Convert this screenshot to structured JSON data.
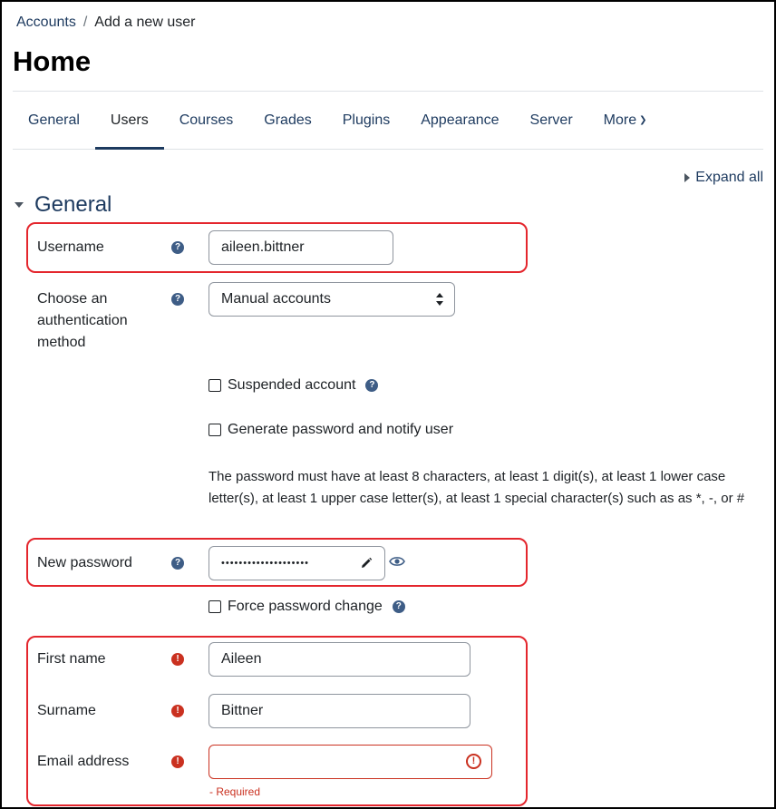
{
  "breadcrumb": {
    "parent": "Accounts",
    "separator": "/",
    "current": "Add a new user"
  },
  "page": {
    "title": "Home"
  },
  "tabs": [
    {
      "label": "General",
      "active": false
    },
    {
      "label": "Users",
      "active": true
    },
    {
      "label": "Courses",
      "active": false
    },
    {
      "label": "Grades",
      "active": false
    },
    {
      "label": "Plugins",
      "active": false
    },
    {
      "label": "Appearance",
      "active": false
    },
    {
      "label": "Server",
      "active": false
    },
    {
      "label": "More",
      "active": false
    }
  ],
  "expand_all": "Expand all",
  "section": {
    "title": "General"
  },
  "form": {
    "username": {
      "label": "Username",
      "value": "aileen.bittner"
    },
    "auth": {
      "label": "Choose an authentication method",
      "selected": "Manual accounts"
    },
    "suspended": {
      "label": "Suspended account",
      "checked": false
    },
    "generate": {
      "label": "Generate password and notify user",
      "checked": false
    },
    "password_policy": "The password must have at least 8 characters, at least 1 digit(s), at least 1 lower case letter(s), at least 1 upper case letter(s), at least 1 special character(s) such as as *, -, or #",
    "new_password": {
      "label": "New password",
      "masked_value": "••••••••••••••••••••"
    },
    "force_change": {
      "label": "Force password change",
      "checked": false
    },
    "first_name": {
      "label": "First name",
      "value": "Aileen"
    },
    "surname": {
      "label": "Surname",
      "value": "Bittner"
    },
    "email": {
      "label": "Email address",
      "value": "",
      "error": "- Required"
    }
  },
  "colors": {
    "brand": "#1d3a5f",
    "help_icon": "#3e5d86",
    "required": "#ca3120",
    "highlight": "#e4262d"
  },
  "icons": {
    "help": "question-circle-icon",
    "required": "exclamation-circle-icon",
    "edit": "pencil-icon",
    "reveal": "eye-icon",
    "more_chevron": "chevron-down-icon"
  }
}
